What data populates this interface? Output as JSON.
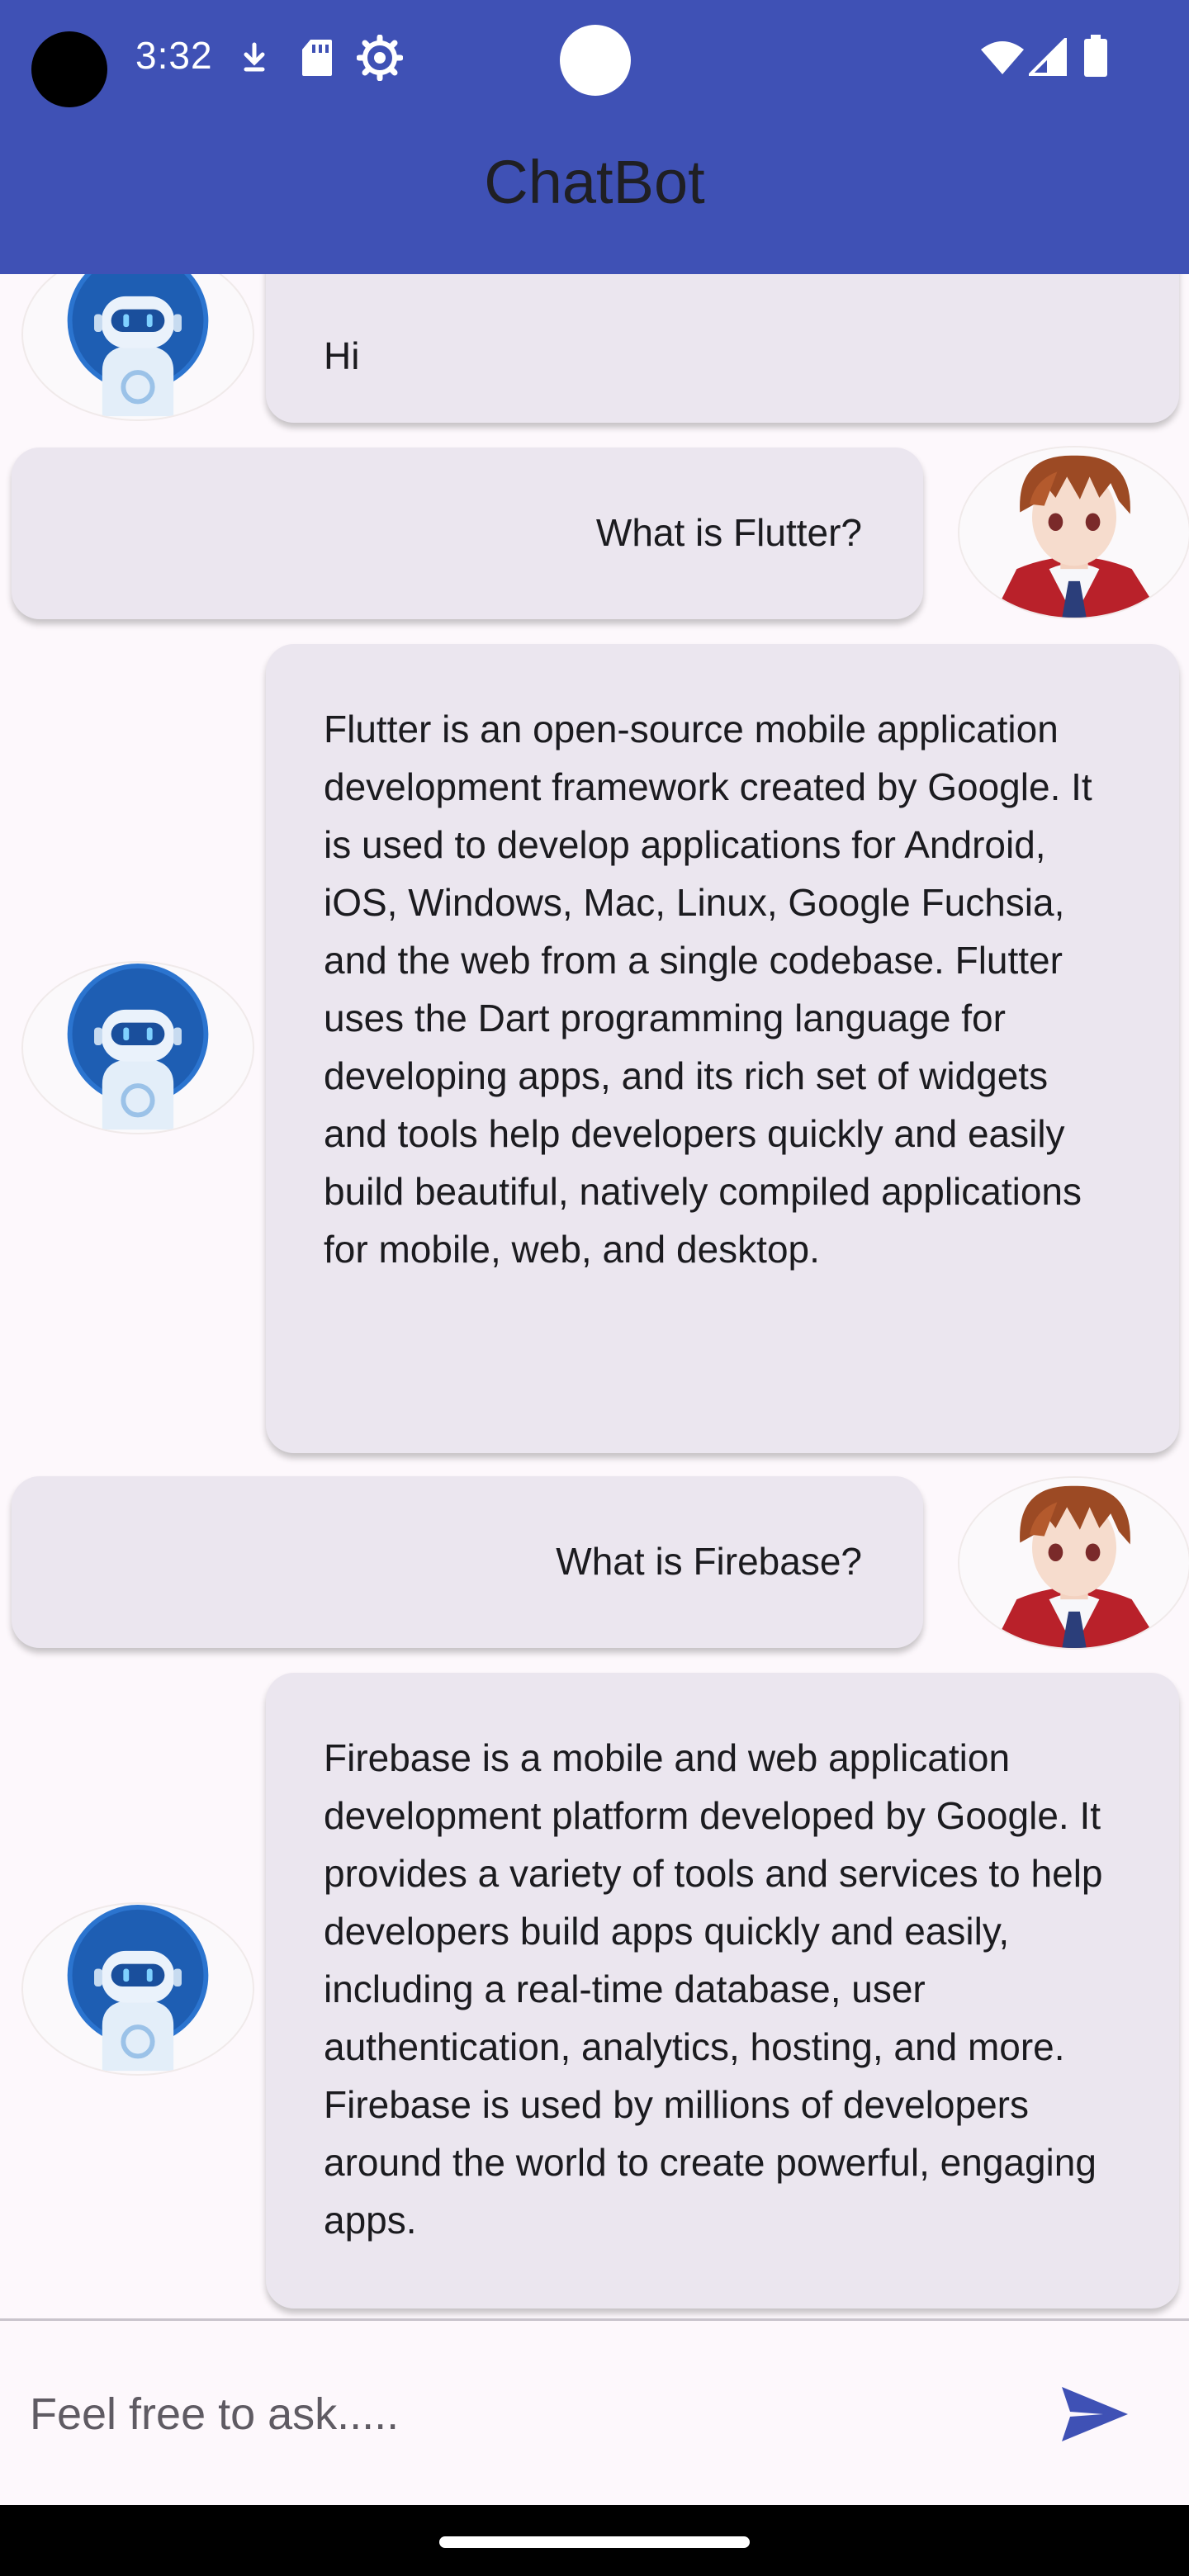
{
  "status_bar": {
    "time": "3:32",
    "left_icons": [
      "download-icon",
      "sd-card-icon",
      "settings-icon"
    ],
    "right_icons": [
      "wifi-icon",
      "cellular-signal-icon",
      "battery-icon"
    ]
  },
  "app_bar": {
    "title": "ChatBot",
    "background": "#3f51b5"
  },
  "messages": [
    {
      "sender": "bot",
      "avatar": "robot-avatar",
      "text": "Hi"
    },
    {
      "sender": "user",
      "avatar": "anime-boy-avatar",
      "text": "What is Flutter?"
    },
    {
      "sender": "bot",
      "avatar": "robot-avatar",
      "text": "Flutter is an open-source mobile application development framework created by Google. It is used to develop applications for Android, iOS, Windows, Mac, Linux, Google Fuchsia, and the web from a single codebase. Flutter uses the Dart programming language for developing apps, and its rich set of widgets and tools help developers quickly and easily build beautiful, natively compiled applications for mobile, web, and desktop."
    },
    {
      "sender": "user",
      "avatar": "anime-boy-avatar",
      "text": "What is Firebase?"
    },
    {
      "sender": "bot",
      "avatar": "robot-avatar",
      "text": "Firebase is a mobile and web application development platform developed by Google. It provides a variety of tools and services to help developers build apps quickly and easily, including a real-time database, user authentication, analytics, hosting, and more. Firebase is used by millions of developers around the world to create powerful, engaging apps."
    }
  ],
  "input": {
    "placeholder": "Feel free to ask.....",
    "value": "",
    "send_icon": "send-icon",
    "accent": "#3f51b5"
  }
}
